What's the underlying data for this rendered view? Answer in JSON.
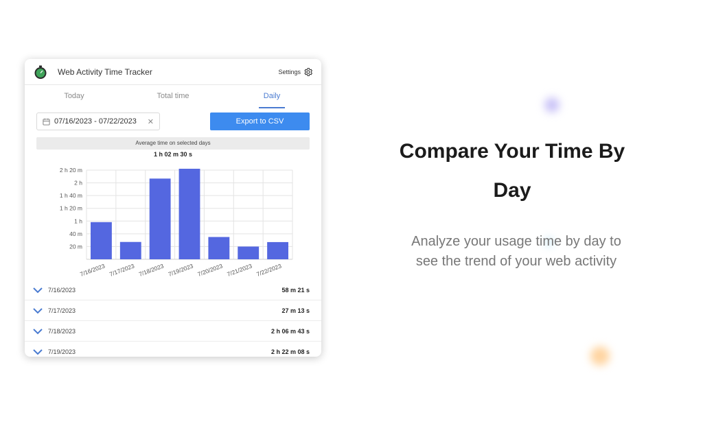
{
  "header": {
    "app_title": "Web Activity Time Tracker",
    "settings_label": "Settings"
  },
  "tabs": [
    {
      "label": "Today",
      "active": false
    },
    {
      "label": "Total time",
      "active": false
    },
    {
      "label": "Daily",
      "active": true
    }
  ],
  "date_range": {
    "value": "07/16/2023 - 07/22/2023"
  },
  "export_label": "Export to CSV",
  "average": {
    "label": "Average time on selected days",
    "value": "1 h 02 m 30 s"
  },
  "chart_data": {
    "type": "bar",
    "categories": [
      "7/16/2023",
      "7/17/2023",
      "7/18/2023",
      "7/19/2023",
      "7/20/2023",
      "7/21/2023",
      "7/22/2023"
    ],
    "values": [
      58.35,
      27.22,
      126.72,
      142.13,
      35,
      20,
      27
    ],
    "y_tick_labels": [
      "20 m",
      "40 m",
      "1 h",
      "1 h 20 m",
      "1 h 40 m",
      "2 h",
      "2 h 20 m"
    ],
    "y_ticks": [
      20,
      40,
      60,
      80,
      100,
      120,
      140
    ],
    "ylim": [
      0,
      140
    ],
    "bar_color": "#5467e0",
    "grid": true
  },
  "day_list": [
    {
      "date": "7/16/2023",
      "time": "58 m 21 s"
    },
    {
      "date": "7/17/2023",
      "time": "27 m 13 s"
    },
    {
      "date": "7/18/2023",
      "time": "2 h 06 m 43 s"
    },
    {
      "date": "7/19/2023",
      "time": "2 h 22 m 08 s"
    }
  ],
  "promo": {
    "headline_line1": "Compare Your Time By",
    "headline_line2": "Day",
    "subtext_line1": "Analyze your usage time by day to",
    "subtext_line2": "see the trend of your web activity"
  },
  "colors": {
    "accent": "#4a7bd1",
    "button": "#3d8bef",
    "bar": "#5467e0"
  },
  "icons": {
    "logo": "stopwatch-icon",
    "settings": "gear-icon",
    "calendar": "calendar-icon",
    "clear": "close-icon",
    "expand": "chevron-down-icon"
  }
}
